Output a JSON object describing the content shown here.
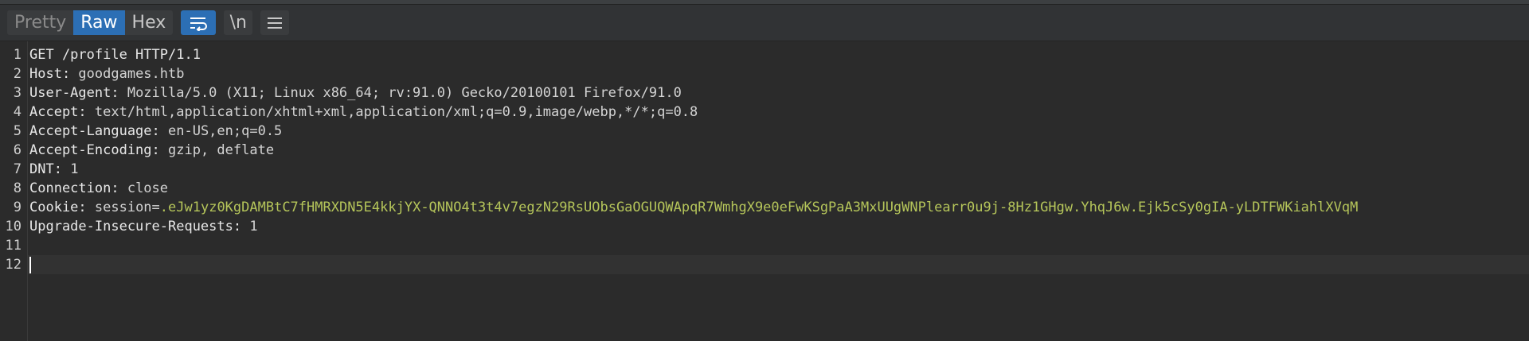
{
  "toolbar": {
    "tabs": [
      {
        "label": "Pretty",
        "active": false
      },
      {
        "label": "Raw",
        "active": true
      },
      {
        "label": "Hex",
        "active": false
      }
    ],
    "wrap_icon": "wrap-lines-icon",
    "newline_label": "\\n",
    "menu_icon": "hamburger-menu-icon"
  },
  "request": {
    "request_line": "GET /profile HTTP/1.1",
    "headers": [
      {
        "name": "Host:",
        "value": " goodgames.htb"
      },
      {
        "name": "User-Agent:",
        "value": " Mozilla/5.0 (X11; Linux x86_64; rv:91.0) Gecko/20100101 Firefox/91.0"
      },
      {
        "name": "Accept:",
        "value": " text/html,application/xhtml+xml,application/xml;q=0.9,image/webp,*/*;q=0.8"
      },
      {
        "name": "Accept-Language:",
        "value": " en-US,en;q=0.5"
      },
      {
        "name": "Accept-Encoding:",
        "value": " gzip, deflate"
      },
      {
        "name": "DNT:",
        "value": " 1"
      },
      {
        "name": "Connection:",
        "value": " close"
      }
    ],
    "cookie": {
      "name": "Cookie:",
      "param": " session",
      "eq": "=",
      "value": ".eJw1yz0KgDAMBtC7fHMRXDN5E4kkjYX-QNNO4t3t4v7egzN29RsUObsGaOGUQWApqR7WmhgX9e0eFwKSgPaA3MxUUgWNPlearr0u9j-8Hz1GHgw.YhqJ6w.Ejk5cSy0gIA-yLDTFWKiahlXVqM"
    },
    "upgrade": {
      "name": "Upgrade-Insecure-Requests:",
      "value": " 1"
    }
  },
  "line_numbers": [
    "1",
    "2",
    "3",
    "4",
    "5",
    "6",
    "7",
    "8",
    "9",
    "10",
    "11",
    "12"
  ],
  "colors": {
    "accent": "#2c6fb5",
    "cookie_value": "#b5c55a",
    "background": "#2b2b2b"
  }
}
